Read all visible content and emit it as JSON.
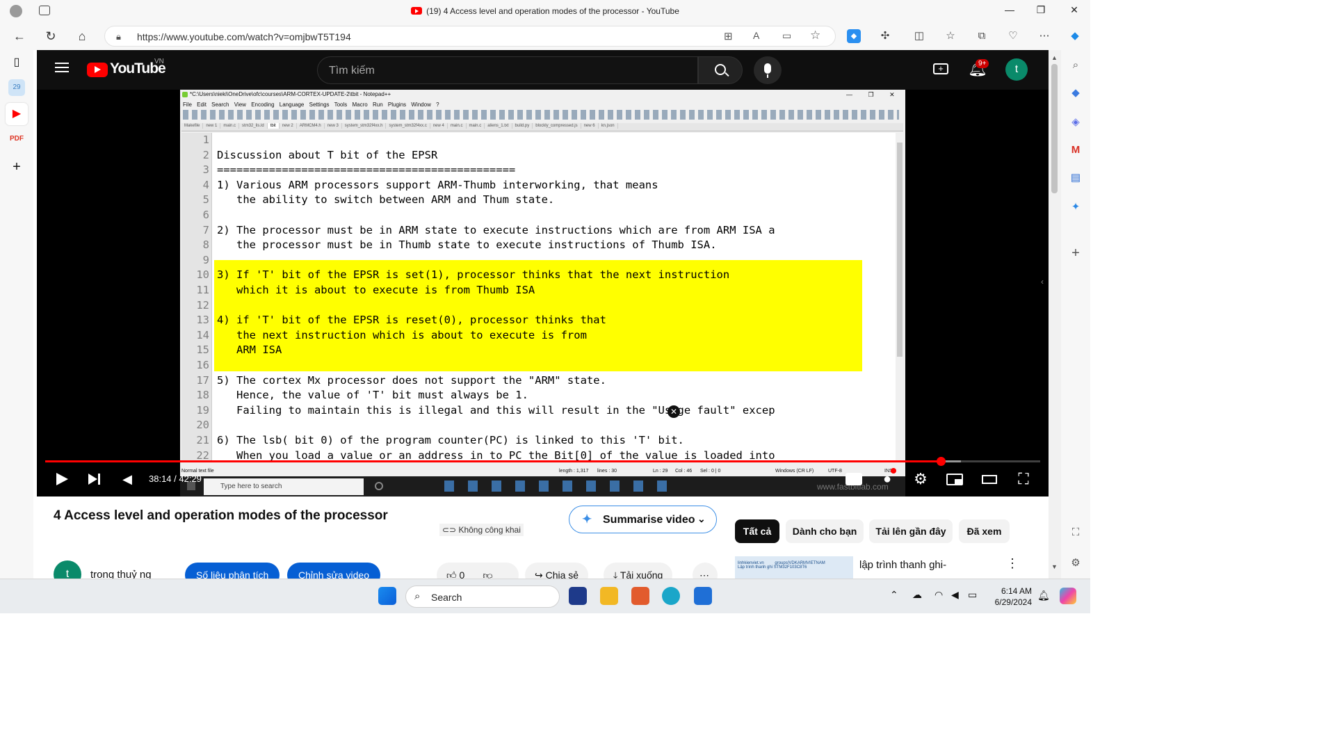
{
  "browser": {
    "window_title": "(19) 4 Access level and operation modes of the processor - YouTube",
    "url": "https://www.youtube.com/watch?v=omjbwT5T194"
  },
  "youtube": {
    "logo_text": "YouTube",
    "region": "VN",
    "search_placeholder": "Tìm kiếm",
    "notification_count": "9+",
    "avatar_letter": "t"
  },
  "notepad": {
    "window_title": "*C:\\Users\\nieki\\OneDrive\\ofc\\courses\\ARM-CORTEX-UPDATE-2\\tbit - Notepad++",
    "menu": [
      "File",
      "Edit",
      "Search",
      "View",
      "Encoding",
      "Language",
      "Settings",
      "Tools",
      "Macro",
      "Run",
      "Plugins",
      "Window",
      "?"
    ],
    "tabs": [
      "Makefile",
      "new 1",
      "main.c",
      "stm32_lis.ld",
      "tbit",
      "new 2",
      "ARMCM4.h",
      "new 3",
      "system_stm32f4xx.h",
      "system_stm32f4xx.c",
      "new 4",
      "main.c",
      "main.c",
      "aliens_1.txt",
      "build.py",
      "blockly_compressed.js",
      "new 6",
      "kn.json"
    ],
    "lines": [
      {
        "n": "1",
        "text": ""
      },
      {
        "n": "2",
        "text": "Discussion about T bit of the EPSR"
      },
      {
        "n": "3",
        "text": "=============================================="
      },
      {
        "n": "4",
        "text": "1) Various ARM processors support ARM-Thumb interworking, that means"
      },
      {
        "n": "5",
        "text": "   the ability to switch between ARM and Thum state."
      },
      {
        "n": "6",
        "text": ""
      },
      {
        "n": "7",
        "text": "2) The processor must be in ARM state to execute instructions which are from ARM ISA a"
      },
      {
        "n": "8",
        "text": "   the processor must be in Thumb state to execute instructions of Thumb ISA."
      },
      {
        "n": "9",
        "text": ""
      },
      {
        "n": "10",
        "text": "3) If 'T' bit of the EPSR is set(1), processor thinks that the next instruction"
      },
      {
        "n": "11",
        "text": "   which it is about to execute is from Thumb ISA"
      },
      {
        "n": "12",
        "text": ""
      },
      {
        "n": "13",
        "text": "4) if 'T' bit of the EPSR is reset(0), processor thinks that"
      },
      {
        "n": "14",
        "text": "   the next instruction which is about to execute is from"
      },
      {
        "n": "15",
        "text": "   ARM ISA"
      },
      {
        "n": "16",
        "text": ""
      },
      {
        "n": "17",
        "text": "5) The cortex Mx processor does not support the \"ARM\" state."
      },
      {
        "n": "18",
        "text": "   Hence, the value of 'T' bit must always be 1."
      },
      {
        "n": "19",
        "text": "   Failing to maintain this is illegal and this will result in the \"Usage fault\" excep"
      },
      {
        "n": "20",
        "text": ""
      },
      {
        "n": "21",
        "text": "6) The lsb( bit 0) of the program counter(PC) is linked to this 'T' bit."
      },
      {
        "n": "22",
        "text": "   When you load a value or an address in to PC the Bit[0] of the value is loaded into"
      }
    ],
    "status": {
      "type": "Normal text file",
      "length": "length : 1,317",
      "lines": "lines : 30",
      "pos": "Ln : 29",
      "col": "Col : 46",
      "sel": "Sel : 0 | 0",
      "eol": "Windows (CR LF)",
      "enc": "UTF-8",
      "mode": "INS"
    },
    "taskbar_search": "Type here to search",
    "watermark": "www.fastbitlab.com"
  },
  "player": {
    "time": "38:14 / 42:29",
    "progress": 0.9
  },
  "video": {
    "title": "4 Access level and operation modes of the processor",
    "privacy": "Không công khai",
    "summarise": "Summarise video",
    "channel": "trong thuỷ ng",
    "analytics_btn": "Số liệu phân tích",
    "edit_btn": "Chỉnh sửa video",
    "likes": "0",
    "share": "Chia sẻ",
    "download": "Tải xuống"
  },
  "chips": [
    "Tất cả",
    "Dành cho bạn",
    "Tải lên gần đây",
    "Đã xem"
  ],
  "recommendation": {
    "title": "lập trình thanh ghi-",
    "thumb_text_1": "linhkienviet.vn",
    "thumb_text_2": "groups/VDKARMVIETNAM",
    "thumb_text_3": "Lập trình thanh ghi STM32F103C8T6"
  },
  "taskbar": {
    "search": "Search",
    "time": "6:14 AM",
    "date": "6/29/2024"
  },
  "colors": {
    "youtube_red": "#ff0000",
    "highlight": "#ffff00",
    "accent_blue": "#065fd4"
  }
}
